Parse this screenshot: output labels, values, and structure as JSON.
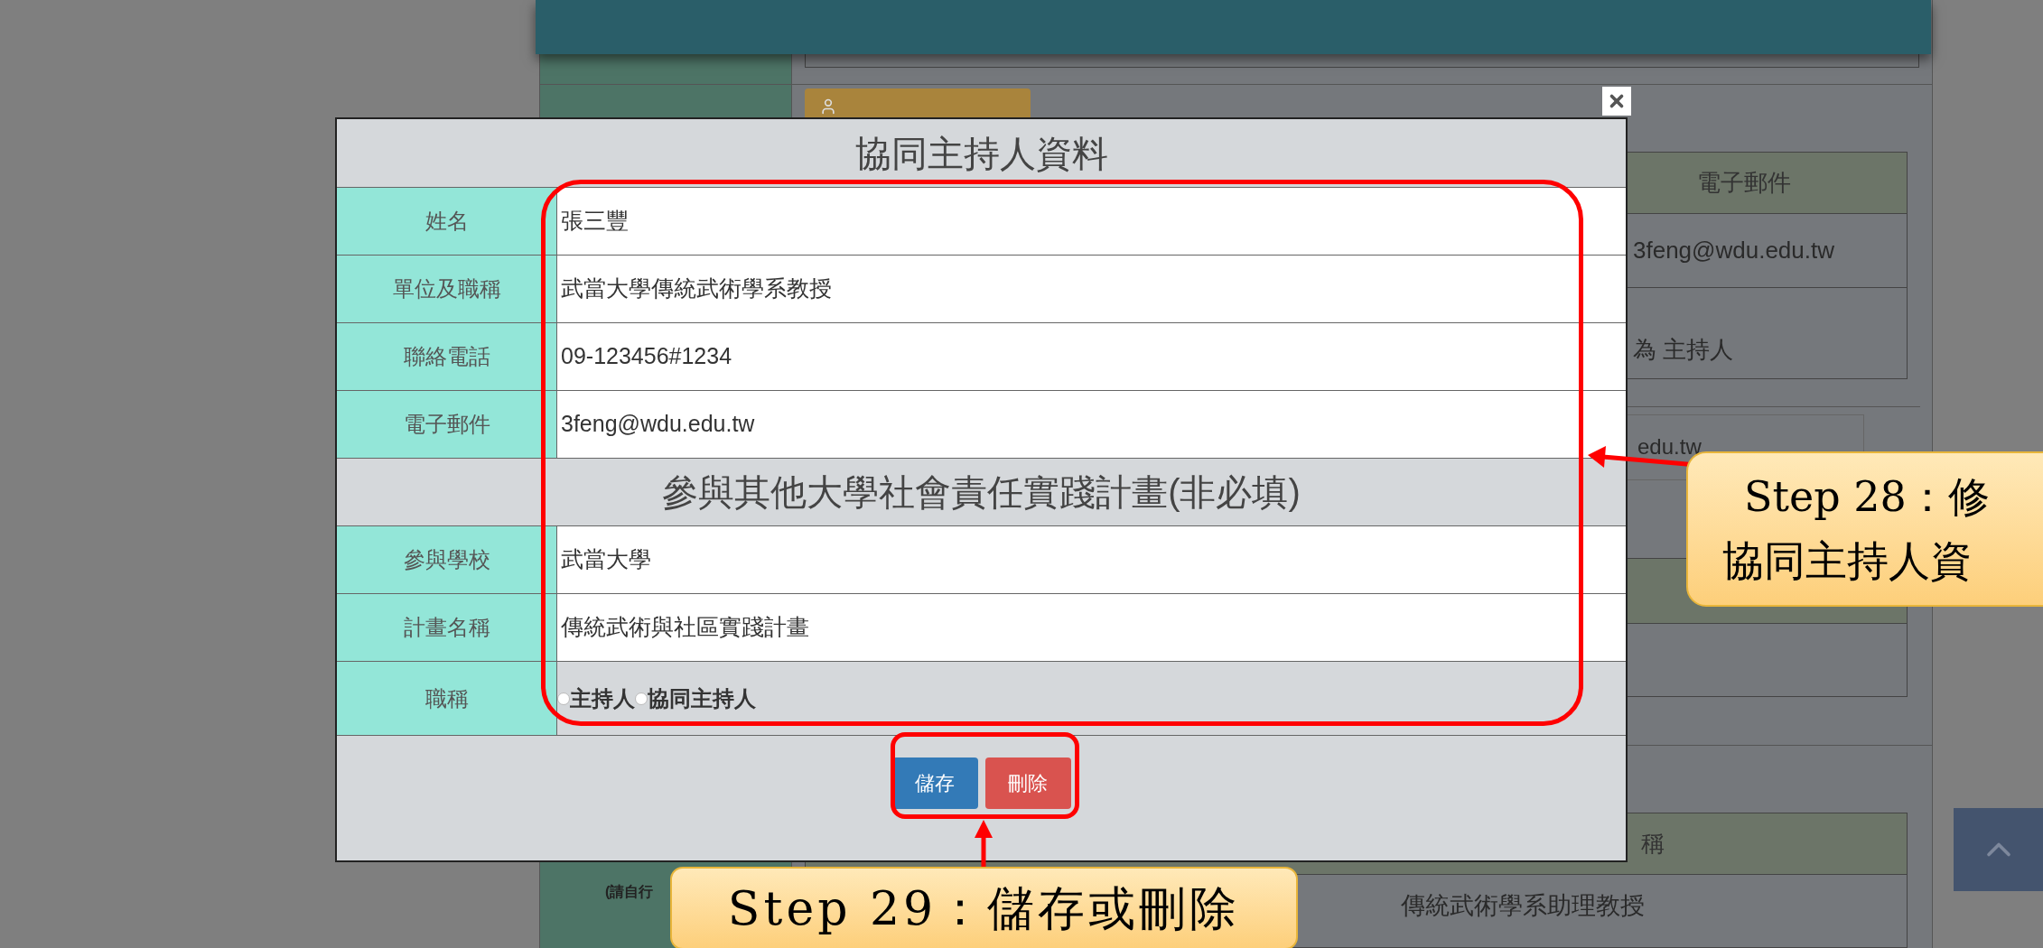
{
  "background_page": {
    "email_table": {
      "header": "電子郵件",
      "email": "3feng@wdu.edu.tw",
      "role": "為 主持人"
    },
    "email_input": "edu.tw",
    "title_table": {
      "header": "稱",
      "value": "傳統武術學系助理教授"
    },
    "note": "(請自行"
  },
  "dialog": {
    "title": "協同主持人資料",
    "fields": [
      {
        "label": "姓名",
        "value": "張三豐"
      },
      {
        "label": "單位及職稱",
        "value": "武當大學傳統武術學系教授"
      },
      {
        "label": "聯絡電話",
        "value": "09-123456#1234"
      },
      {
        "label": "電子郵件",
        "value": "3feng@wdu.edu.tw"
      }
    ],
    "section_title": "參與其他大學社會責任實踐計畫(非必填)",
    "extra_fields": [
      {
        "label": "參與學校",
        "value": "武當大學"
      },
      {
        "label": "計畫名稱",
        "value": "傳統武術與社區實踐計畫"
      }
    ],
    "role_field": {
      "label": "職稱",
      "options": [
        {
          "label": "主持人",
          "selected": false
        },
        {
          "label": "協同主持人",
          "selected": false
        }
      ]
    },
    "buttons": [
      {
        "label": "儲存",
        "kind": "primary"
      },
      {
        "label": "刪除",
        "kind": "danger"
      }
    ]
  },
  "annotations": [
    {
      "lines": [
        "Step 28：修",
        "協同主持人資"
      ]
    },
    {
      "lines": [
        "Step 29：儲存或刪除"
      ]
    }
  ]
}
